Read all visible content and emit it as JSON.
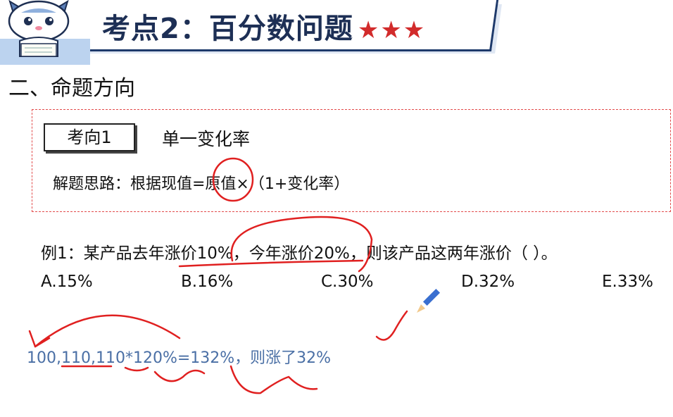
{
  "header": {
    "title": "考点2：百分数问题",
    "stars": "★★★"
  },
  "section_heading": "二、命题方向",
  "box": {
    "tag": "考向1",
    "tag_title": "单一变化率",
    "idea": "解题思路：根据现值=原值×（1+变化率）"
  },
  "question": {
    "stem": "例1：某产品去年涨价10%，今年涨价20%，则该产品这两年涨价（    ）。",
    "options": [
      "A.15%",
      "B.16%",
      "C.30%",
      "D.32%",
      "E.33%"
    ]
  },
  "handwritten_calc": "100,110,110*120%=132%，则涨了32%",
  "colors": {
    "ink_red": "#e02020",
    "title_navy": "#1d2f55",
    "calc_blue": "#4a6fa5",
    "star_red": "#d22b2b"
  },
  "icons": [
    "cat-mascot-icon",
    "pencil-icon"
  ]
}
